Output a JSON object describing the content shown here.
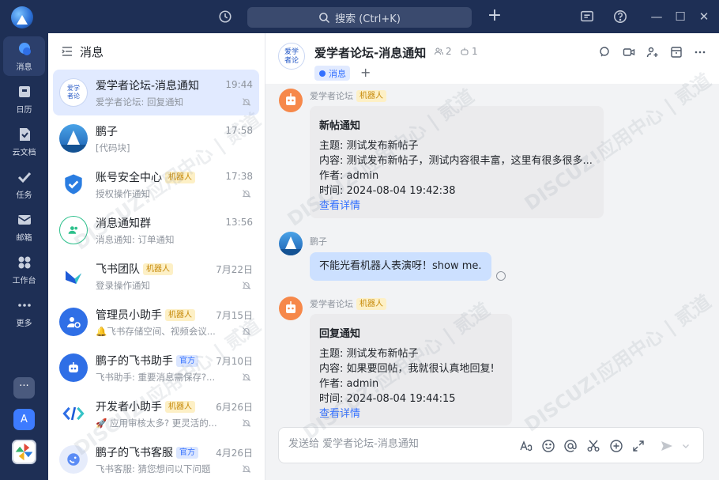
{
  "app": {
    "search_placeholder": "搜索 (Ctrl+K)"
  },
  "rail": {
    "items": [
      {
        "label": "消息",
        "icon": "chat-bubble-icon"
      },
      {
        "label": "日历",
        "icon": "calendar-icon"
      },
      {
        "label": "云文档",
        "icon": "doc-icon"
      },
      {
        "label": "任务",
        "icon": "task-check-icon"
      },
      {
        "label": "邮箱",
        "icon": "mail-icon"
      },
      {
        "label": "工作台",
        "icon": "grid-icon"
      },
      {
        "label": "更多",
        "icon": "more-dots-icon"
      }
    ],
    "bottom": [
      {
        "label": "···"
      },
      {
        "label": "A"
      }
    ]
  },
  "conv_list": {
    "header": "消息",
    "items": [
      {
        "name": "爱学者论坛-消息通知",
        "time": "19:44",
        "preview": "爱学者论坛: 回复通知",
        "tag": "",
        "muted": true,
        "avatar_text": "爱学\n者论"
      },
      {
        "name": "鹏子",
        "time": "17:58",
        "preview": "[代码块]",
        "tag": "",
        "muted": false
      },
      {
        "name": "账号安全中心",
        "time": "17:38",
        "preview": "授权操作通知",
        "tag": "机器人",
        "muted": true
      },
      {
        "name": "消息通知群",
        "time": "13:56",
        "preview": "消息通知: 订单通知",
        "tag": "",
        "muted": false
      },
      {
        "name": "飞书团队",
        "time": "7月22日",
        "preview": "登录操作通知",
        "tag": "机器人",
        "muted": true
      },
      {
        "name": "管理员小助手",
        "time": "7月15日",
        "preview": "🔔飞书存储空间、视频会议...",
        "tag": "机器人",
        "muted": true
      },
      {
        "name": "鹏子的飞书助手",
        "time": "7月10日",
        "preview": "飞书助手: 重要消息需保存?...",
        "tag": "官方",
        "muted": true
      },
      {
        "name": "开发者小助手",
        "time": "6月26日",
        "preview": "🚀 应用审核太多? 更灵活的...",
        "tag": "机器人",
        "muted": true
      },
      {
        "name": "鹏子的飞书客服",
        "time": "4月26日",
        "preview": "飞书客服: 猜您想问以下问题",
        "tag": "官方",
        "muted": true
      }
    ]
  },
  "chat": {
    "avatar_text": "爱学\n者论",
    "title": "爱学者论坛-消息通知",
    "members": "2",
    "bots": "1",
    "tab_label": "消息",
    "messages": [
      {
        "sender": "爱学者论坛",
        "tag": "机器人",
        "card_title": "新帖通知",
        "lines": [
          "主题: 测试发布新帖子",
          "内容: 测试发布新帖子，测试内容很丰富，这里有很多很多...",
          "作者: admin",
          "时间: 2024-08-04 19:42:38"
        ],
        "link": "查看详情"
      },
      {
        "sender": "鹏子",
        "text": "不能光看机器人表演呀！show me."
      },
      {
        "sender": "爱学者论坛",
        "tag": "机器人",
        "card_title": "回复通知",
        "lines": [
          "主题: 测试发布新帖子",
          "内容: 如果要回帖，我就很认真地回复!",
          "作者: admin",
          "时间: 2024-08-04 19:44:15"
        ],
        "link": "查看详情"
      }
    ],
    "composer_placeholder": "发送给 爱学者论坛-消息通知"
  },
  "watermark": "DISCUZ!应用中心 | 贰道",
  "colors": {
    "rail_bg": "#1e2f55",
    "accent": "#3370ff",
    "robot_tag": "#c78a0a",
    "active_item": "#e1eaff"
  }
}
